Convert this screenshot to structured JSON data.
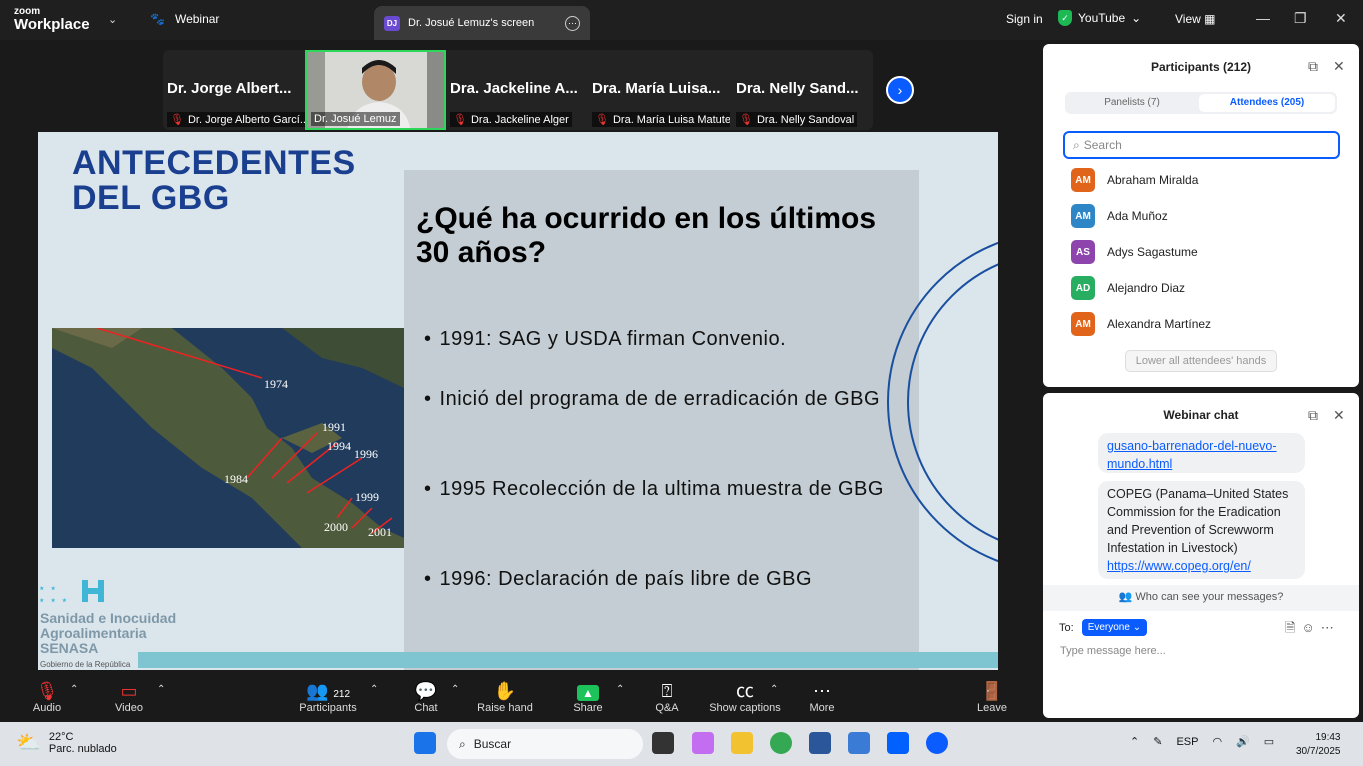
{
  "titlebar": {
    "brand_small": "zoom",
    "brand_large": "Workplace",
    "webinar_label": "Webinar",
    "screen_tab": {
      "initials": "DJ",
      "label": "Dr. Josué Lemuz's screen"
    },
    "sign_in": "Sign in",
    "youtube": "YouTube",
    "view": "View"
  },
  "video_strip": {
    "tiles": [
      {
        "display": "Dr. Jorge Albert...",
        "caption": "Dr. Jorge Alberto Garcí..."
      },
      {
        "display": "",
        "caption": "Dr. Josué Lemuz"
      },
      {
        "display": "Dra. Jackeline A...",
        "caption": "Dra. Jackeline Alger"
      },
      {
        "display": "Dra. María Luisa...",
        "caption": "Dra. María Luisa Matute"
      },
      {
        "display": "Dra. Nelly Sand...",
        "caption": "Dra. Nelly Sandoval"
      }
    ]
  },
  "slide": {
    "title": "ANTECEDENTES\nDEL GBG",
    "heading": "¿Qué ha ocurrido en los últimos 30 años?",
    "bullets": [
      "1991: SAG y USDA firman Convenio.",
      "Inició del programa de de erradicación de GBG",
      "1995 Recolección de la ultima muestra de GBG",
      "1996: Declaración de país libre de GBG"
    ],
    "map_years": [
      "1974",
      "1991",
      "1994",
      "1996",
      "1984",
      "1999",
      "2000",
      "2001"
    ],
    "logo": {
      "line1": "Sanidad e Inocuidad",
      "line2": "Agroalimentaria",
      "line3": "SENASA",
      "line4": "Gobierno de la República"
    }
  },
  "toolbar": {
    "audio": "Audio",
    "video": "Video",
    "participants": "Participants",
    "participants_count": "212",
    "chat": "Chat",
    "raise_hand": "Raise hand",
    "share": "Share",
    "qa": "Q&A",
    "captions": "Show captions",
    "more": "More",
    "leave": "Leave"
  },
  "participants_panel": {
    "title": "Participants (212)",
    "tab_panelists": "Panelists (7)",
    "tab_attendees": "Attendees (205)",
    "search_placeholder": "Search",
    "attendees": [
      {
        "initials": "AM",
        "name": "Abraham Miralda",
        "color": "#e0651b"
      },
      {
        "initials": "AM",
        "name": "Ada Muñoz",
        "color": "#2e86c7"
      },
      {
        "initials": "AS",
        "name": "Adys Sagastume",
        "color": "#8e44ad"
      },
      {
        "initials": "AD",
        "name": "Alejandro Diaz",
        "color": "#27ae60"
      },
      {
        "initials": "AM",
        "name": "Alexandra Martínez",
        "color": "#e0651b"
      }
    ],
    "lower_hands": "Lower all attendees' hands"
  },
  "chat_panel": {
    "title": "Webinar chat",
    "msg1_link": "gusano-barrenador-del-nuevo-mundo.html",
    "msg2_text": "COPEG (Panama–United States Commission for the Eradication and Prevention of Screwworm Infestation in Livestock)",
    "msg2_link": "https://www.copeg.org/en/",
    "who_can_see": "Who can see your messages?",
    "to_label": "To:",
    "to_value": "Everyone",
    "input_placeholder": "Type message here..."
  },
  "taskbar": {
    "temperature": "22°C",
    "weather": "Parc. nublado",
    "search": "Buscar",
    "lang": "ESP",
    "time": "19:43",
    "date": "30/7/2025"
  }
}
